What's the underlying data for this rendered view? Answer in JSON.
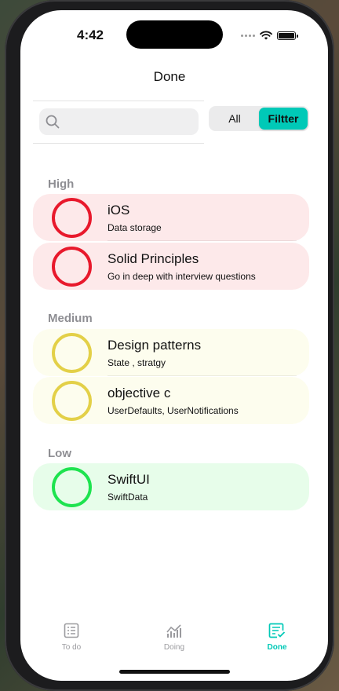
{
  "status_bar": {
    "time": "4:42"
  },
  "nav": {
    "title": "Done"
  },
  "search": {
    "placeholder": ""
  },
  "filter": {
    "options": [
      "All",
      "Filtter"
    ],
    "selected": "Filtter"
  },
  "colors": {
    "accent": "#00c9b7",
    "high_ring": "#e8192c",
    "high_bg": "#fde9ea",
    "medium_ring": "#e3d048",
    "medium_bg": "#fdfdee",
    "low_ring": "#1ee34f",
    "low_bg": "#e7fdea"
  },
  "sections": [
    {
      "header": "High",
      "items": [
        {
          "title": "iOS",
          "subtitle": "Data storage"
        },
        {
          "title": "Solid Principles",
          "subtitle": "Go in deep with interview questions"
        }
      ]
    },
    {
      "header": "Medium",
      "items": [
        {
          "title": "Design patterns",
          "subtitle": "State , stratgy"
        },
        {
          "title": "objective c",
          "subtitle": "UserDefaults, UserNotifications"
        }
      ]
    },
    {
      "header": "Low",
      "items": [
        {
          "title": "SwiftUI",
          "subtitle": "SwiftData"
        }
      ]
    }
  ],
  "tabs": [
    {
      "label": "To do",
      "icon": "list-icon"
    },
    {
      "label": "Doing",
      "icon": "chart-icon"
    },
    {
      "label": "Done",
      "icon": "done-list-icon",
      "active": true
    }
  ]
}
